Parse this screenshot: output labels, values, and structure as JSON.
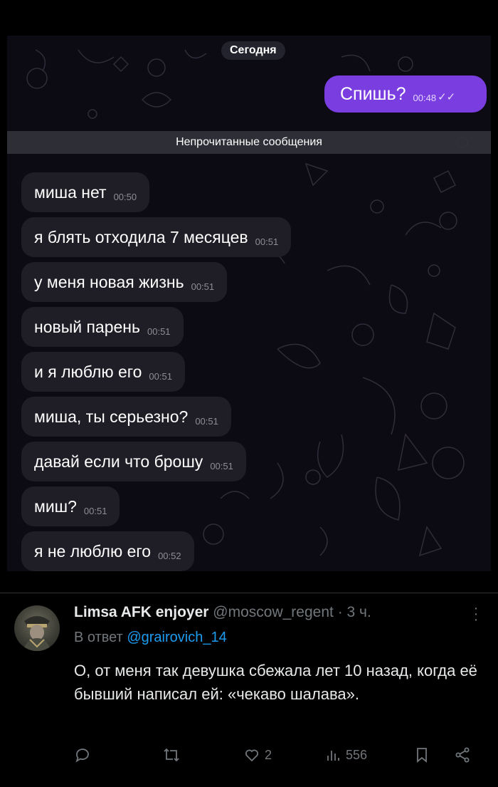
{
  "chat": {
    "date_label": "Сегодня",
    "outgoing": {
      "text": "Спишь?",
      "time": "00:48",
      "status_icon": "double-check-icon"
    },
    "unread_label": "Непрочитанные сообщения",
    "messages": [
      {
        "text": "миша нет",
        "time": "00:50"
      },
      {
        "text": "я блять отходила 7 месяцев",
        "time": "00:51"
      },
      {
        "text": "у меня новая жизнь",
        "time": "00:51"
      },
      {
        "text": "новый парень",
        "time": "00:51"
      },
      {
        "text": "и я люблю его",
        "time": "00:51"
      },
      {
        "text": "миша, ты серьезно?",
        "time": "00:51"
      },
      {
        "text": "давай если что брошу",
        "time": "00:51"
      },
      {
        "text": "миш?",
        "time": "00:51"
      },
      {
        "text": "я не люблю его",
        "time": "00:52"
      }
    ],
    "colors": {
      "outgoing_bubble": "#7a3ee0",
      "incoming_bubble": "#1f1e26",
      "background": "#0c0a12"
    }
  },
  "tweet": {
    "display_name": "Limsa AFK enjoyer",
    "handle": "@moscow_regent",
    "separator": "·",
    "time_ago": "3 ч.",
    "reply_prefix": "В ответ",
    "reply_mention": "@grairovich_14",
    "text": "О, от меня так девушка сбежала лет 10 назад, когда её бывший написал ей: «чекаво шалава».",
    "actions": {
      "reply": {
        "icon": "reply-icon"
      },
      "repost": {
        "icon": "repost-icon"
      },
      "like": {
        "icon": "heart-icon",
        "count": "2"
      },
      "views": {
        "icon": "views-icon",
        "count": "556"
      },
      "bookmark": {
        "icon": "bookmark-icon"
      },
      "share": {
        "icon": "share-icon"
      }
    },
    "colors": {
      "accent": "#1d9bf0",
      "muted": "#71767b",
      "text": "#e7e9ea"
    }
  }
}
